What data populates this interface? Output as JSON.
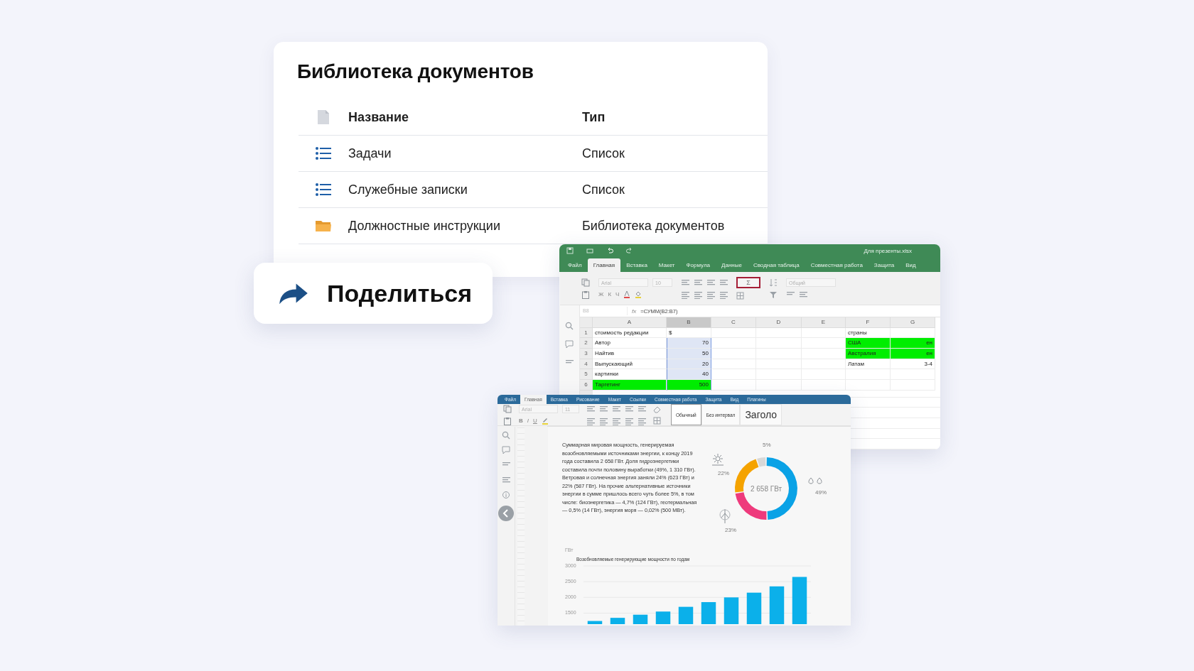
{
  "library": {
    "title": "Библиотека документов",
    "columns": [
      "Название",
      "Тип"
    ],
    "rows": [
      {
        "kind": "list",
        "name": "Задачи",
        "type": "Список"
      },
      {
        "kind": "list",
        "name": "Служебные записки",
        "type": "Список"
      },
      {
        "kind": "folder",
        "name": "Должностные инструкции",
        "type": "Библиотека документов"
      }
    ]
  },
  "share_button": {
    "label": "Поделиться"
  },
  "spreadsheet": {
    "title": "Для презенты.xlsx",
    "tabs": [
      {
        "label": "Файл",
        "selected": false
      },
      {
        "label": "Главная",
        "selected": true
      },
      {
        "label": "Вставка",
        "selected": false
      },
      {
        "label": "Макет",
        "selected": false
      },
      {
        "label": "Формула",
        "selected": false
      },
      {
        "label": "Данные",
        "selected": false
      },
      {
        "label": "Сводная таблица",
        "selected": false
      },
      {
        "label": "Совместная работа",
        "selected": false
      },
      {
        "label": "Защита",
        "selected": false
      },
      {
        "label": "Вид",
        "selected": false
      }
    ],
    "font": "Arial",
    "font_size": "10",
    "format_buttons": [
      "Ж",
      "К",
      "Ч"
    ],
    "sum_button": "Σ",
    "number_format": "Общий",
    "cell_ref": "B8",
    "fx": "fx",
    "formula": "=СУММ(B2:B7)",
    "columns": [
      {
        "label": "A",
        "selected": false
      },
      {
        "label": "B",
        "selected": true
      },
      {
        "label": "C",
        "selected": false
      },
      {
        "label": "D",
        "selected": false
      },
      {
        "label": "E",
        "selected": false
      },
      {
        "label": "F",
        "selected": false
      },
      {
        "label": "G",
        "selected": false
      }
    ],
    "rows": [
      {
        "number": "1",
        "cells": [
          {
            "text": "стоимость редакции",
            "selected": false
          },
          {
            "text": "$",
            "selected": false
          },
          null,
          null,
          null,
          {
            "text": "страны",
            "selected": false
          },
          null
        ]
      },
      {
        "number": "2",
        "cells": [
          {
            "text": "Автор",
            "selected": false
          },
          {
            "text": "70",
            "selected": true
          },
          null,
          null,
          null,
          {
            "text": "США",
            "selected": false,
            "color": "#00ee00"
          },
          {
            "text": "ен",
            "selected": false,
            "color": "#00ee00"
          }
        ]
      },
      {
        "number": "3",
        "cells": [
          {
            "text": "Найтив",
            "selected": false
          },
          {
            "text": "50",
            "selected": true
          },
          null,
          null,
          null,
          {
            "text": "Австралия",
            "selected": false,
            "color": "#00ee00"
          },
          {
            "text": "ен",
            "selected": false,
            "color": "#00ee00"
          }
        ]
      },
      {
        "number": "4",
        "cells": [
          {
            "text": "Выпускающий",
            "selected": false
          },
          {
            "text": "20",
            "selected": true
          },
          null,
          null,
          null,
          {
            "text": "Латам",
            "selected": false
          },
          {
            "text": "3-4",
            "selected": false
          }
        ]
      },
      {
        "number": "5",
        "cells": [
          {
            "text": "картинки",
            "selected": false
          },
          {
            "text": "40",
            "selected": true
          },
          null,
          null,
          null,
          null,
          null
        ]
      },
      {
        "number": "6",
        "cells": [
          {
            "text": "Таргетинг",
            "selected": false,
            "color": "#00ee00"
          },
          {
            "text": "500",
            "selected": true,
            "color": "#00ee00"
          },
          null,
          null,
          null,
          null,
          null
        ]
      }
    ]
  },
  "document": {
    "tabs": [
      {
        "label": "Файл",
        "selected": false
      },
      {
        "label": "Главная",
        "selected": true
      },
      {
        "label": "Вставка",
        "selected": false
      },
      {
        "label": "Рисование",
        "selected": false
      },
      {
        "label": "Макет",
        "selected": false
      },
      {
        "label": "Ссылки",
        "selected": false
      },
      {
        "label": "Совместная работа",
        "selected": false
      },
      {
        "label": "Защита",
        "selected": false
      },
      {
        "label": "Вид",
        "selected": false
      },
      {
        "label": "Плагины",
        "selected": false
      }
    ],
    "font": "Arial",
    "font_size": "11",
    "format_buttons": [
      "B",
      "I",
      "U"
    ],
    "styles": [
      {
        "label": "Обычный",
        "kind": "normal",
        "selected": true
      },
      {
        "label": "Без интервал",
        "kind": "normal",
        "selected": false
      },
      {
        "label": "Заголо",
        "kind": "heading",
        "selected": false
      }
    ],
    "paragraph": "Суммарная мировая мощность, генерируемая возобновляемыми источниками энергии, к концу 2019 года составила 2 658 ГВт. Доля гидроэнергетики составила почти половину выработки (49%, 1 310 ГВт). Ветровая и солнечная энергия заняли 24% (623 ГВт) и 22% (587 ГВт). На прочие альтернативные источники энергии в сумме пришлось всего чуть более 5%, в том числе: биоэнергетика — 4,7% (124 ГВт), геотермальная — 0,5% (14 ГВт), энергия моря — 0,02% (500 МВт).",
    "donut": {
      "center_label": "2 658 ГВт",
      "chart_data": {
        "type": "donut",
        "values": [
          49,
          23,
          22,
          5
        ],
        "value_labels": [
          "49%",
          "23%",
          "22%",
          "5%"
        ]
      }
    },
    "bar_chart": {
      "chart_data": {
        "type": "bar",
        "title": "Возобновляемые генерирующие мощности по годам",
        "ylabel": "ГВт",
        "values": [
          1250,
          1350,
          1450,
          1550,
          1700,
          1850,
          2000,
          2150,
          2350,
          2650
        ],
        "grid": true,
        "ylim": [
          1150,
          3000
        ],
        "yticks": [
          1500,
          2000,
          2500,
          3000
        ]
      }
    }
  }
}
